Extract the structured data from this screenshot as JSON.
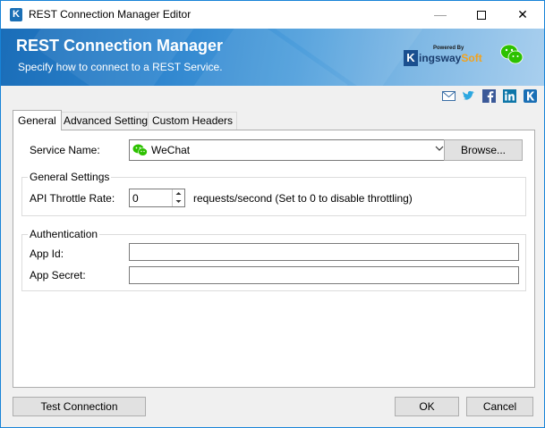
{
  "window": {
    "title": "REST Connection Manager Editor"
  },
  "banner": {
    "title": "REST Connection Manager",
    "subtitle": "Specify how to connect to a REST Service.",
    "logo_powered": "Powered By",
    "logo_brand_a": "ingsway",
    "logo_brand_b": "Soft"
  },
  "social": [
    "mail-icon",
    "twitter-icon",
    "facebook-icon",
    "linkedin-icon",
    "kingswaysoft-icon"
  ],
  "tabs": [
    {
      "label": "General",
      "active": true
    },
    {
      "label": "Advanced Settings",
      "active": false
    },
    {
      "label": "Custom Headers",
      "active": false
    }
  ],
  "general": {
    "service_name_label": "Service Name:",
    "service_name_value": "WeChat",
    "browse_label": "Browse...",
    "settings_group_title": "General Settings",
    "throttle_label": "API Throttle Rate:",
    "throttle_value": "0",
    "throttle_hint": "requests/second (Set to 0 to disable throttling)",
    "auth_group_title": "Authentication",
    "app_id_label": "App Id:",
    "app_id_value": "",
    "app_secret_label": "App Secret:",
    "app_secret_value": ""
  },
  "footer": {
    "test_connection_label": "Test Connection",
    "ok_label": "OK",
    "cancel_label": "Cancel"
  },
  "colors": {
    "accent": "#1883d7",
    "banner_dark": "#1a6db8",
    "wechat_green": "#2dc100"
  }
}
